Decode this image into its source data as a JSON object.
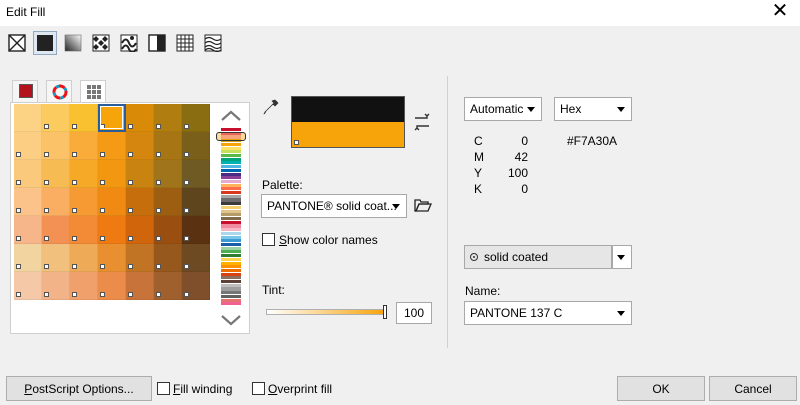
{
  "window": {
    "title": "Edit Fill",
    "close_glyph": "✕"
  },
  "fill_types": [
    {
      "name": "no-fill-icon"
    },
    {
      "name": "uniform-fill-icon"
    },
    {
      "name": "fountain-fill-icon"
    },
    {
      "name": "vector-pattern-fill-icon"
    },
    {
      "name": "bitmap-pattern-fill-icon"
    },
    {
      "name": "two-color-pattern-fill-icon"
    },
    {
      "name": "texture-fill-icon"
    },
    {
      "name": "postscript-fill-icon"
    }
  ],
  "color_tabs": [
    "color-viewers-tab-icon",
    "color-harmonies-tab-icon",
    "color-palettes-tab-icon"
  ],
  "swatches": [
    [
      "#FCD385",
      "#FBCB5F",
      "#F9C12F",
      "#F7A30A",
      "#D98B07",
      "#B07D10",
      "#8A6D10"
    ],
    [
      "#FCCE84",
      "#FBC268",
      "#F9AC3A",
      "#F59A15",
      "#D4860E",
      "#A77514",
      "#7A5F1A"
    ],
    [
      "#FAC97B",
      "#F7BB53",
      "#F6A827",
      "#F29710",
      "#C98310",
      "#A0741B",
      "#6E5A22"
    ],
    [
      "#FBC289",
      "#F9AE61",
      "#F69A33",
      "#F08A12",
      "#C76E0C",
      "#9E5E12",
      "#5F451D"
    ],
    [
      "#F7B68A",
      "#F39155",
      "#F38A35",
      "#EF7A12",
      "#D0650C",
      "#9A4E10",
      "#5A3212"
    ],
    [
      "#F2D4A0",
      "#F0C07C",
      "#EFAA57",
      "#E88F2F",
      "#C07424",
      "#96581C",
      "#6E4A22"
    ],
    [
      "#F5C9A8",
      "#F3B388",
      "#F0A06A",
      "#EC8C4A",
      "#C8733A",
      "#A0602E",
      "#7E4F2A"
    ]
  ],
  "palette_strip_colors": [
    "#c8102e",
    "#e23c8a",
    "#f4a6c8",
    "#d4a017",
    "#f7a30a",
    "#ffe066",
    "#c5e05a",
    "#59b847",
    "#00a37a",
    "#00b3b0",
    "#4fb7e3",
    "#0067b1",
    "#4b2c83",
    "#8c3e96",
    "#e8a9d0",
    "#ffb25b",
    "#ff6b4a",
    "#d9381e",
    "#a6a6a6",
    "#6b6b6b",
    "#3a3a3a",
    "#f4d06f",
    "#e0c48c",
    "#b59a6a",
    "#7f6b4a",
    "#c8102e",
    "#f08a9e",
    "#f7b4c6",
    "#a8d8ea",
    "#78c7e8",
    "#3d9bd4",
    "#1a5ea8",
    "#9bd0a4",
    "#4caf50",
    "#2e7d32",
    "#ffd54f",
    "#ffb300",
    "#ff8f00",
    "#ef6c00",
    "#d84315",
    "#8d6e63",
    "#5d4037",
    "#bdbdbd",
    "#9e9e9e",
    "#757575",
    "#616161",
    "#e57373",
    "#f06292"
  ],
  "preview": {
    "old_color": "#111111",
    "new_color": "#F7A30A"
  },
  "palette": {
    "label": "Palette:",
    "value": "PANTONE® solid coat..."
  },
  "show_names": {
    "prefix": "",
    "accel": "S",
    "rest": "how color names"
  },
  "tint": {
    "label": "Tint:",
    "value": "100",
    "fraction": 1.0
  },
  "model": {
    "value": "Automatic"
  },
  "format": {
    "value": "Hex"
  },
  "cmyk": [
    {
      "label": "C",
      "value": "0"
    },
    {
      "label": "M",
      "value": "42"
    },
    {
      "label": "Y",
      "value": "100"
    },
    {
      "label": "K",
      "value": "0"
    }
  ],
  "hex_value": "#F7A30A",
  "palette_book": {
    "value": "solid coated"
  },
  "name": {
    "label": "Name:",
    "value": "PANTONE 137 C"
  },
  "footer": {
    "postscript": {
      "accel": "P",
      "rest": "ostScript Options..."
    },
    "fill_winding": {
      "accel": "F",
      "rest": "ill winding"
    },
    "overprint": {
      "accel": "O",
      "rest": "verprint fill"
    },
    "ok": "OK",
    "cancel": "Cancel"
  }
}
